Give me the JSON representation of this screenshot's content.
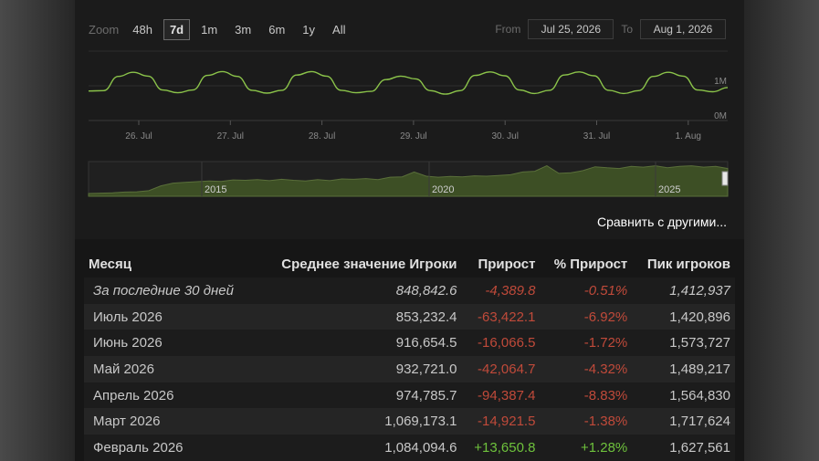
{
  "zoom": {
    "label": "Zoom",
    "options": [
      "48h",
      "7d",
      "1m",
      "3m",
      "6m",
      "1y",
      "All"
    ],
    "active": "7d"
  },
  "range": {
    "from_label": "From",
    "from_value": "Jul 25, 2026",
    "to_label": "To",
    "to_value": "Aug 1, 2026"
  },
  "chart_data": {
    "type": "line",
    "x_ticks": [
      "26. Jul",
      "27. Jul",
      "28. Jul",
      "29. Jul",
      "30. Jul",
      "31. Jul",
      "1. Aug"
    ],
    "y_ticks": [
      "1M",
      "0M"
    ],
    "ylim": [
      0,
      2000000
    ],
    "line_color": "#8bc34a",
    "series": [
      {
        "values": [
          850000,
          860000,
          1270000,
          1390000,
          1280000,
          880000,
          800000,
          880000,
          1300000,
          1410000,
          1270000,
          870000,
          790000,
          870000,
          1310000,
          1410000,
          1280000,
          870000,
          800000,
          840000,
          1180000,
          1280000,
          1200000,
          860000,
          760000,
          860000,
          1300000,
          1400000,
          1290000,
          880000,
          780000,
          870000,
          1310000,
          1400000,
          1290000,
          870000,
          780000,
          860000,
          1270000,
          1390000,
          1280000,
          880000,
          830000,
          950000
        ]
      }
    ]
  },
  "navigator": {
    "year_labels": [
      "2015",
      "2020",
      "2025"
    ],
    "area_color": "#3d4f25"
  },
  "compare_link": "Сравнить с другими...",
  "table": {
    "headers": [
      "Месяц",
      "Среднее значение Игроки",
      "Прирост",
      "% Прирост",
      "Пик игроков"
    ],
    "rows": [
      {
        "month": "За последние 30 дней",
        "avg": "848,842.6",
        "gain": "-4,389.8",
        "pct": "-0.51%",
        "peak": "1,412,937",
        "sign": "neg"
      },
      {
        "month": "Июль 2026",
        "avg": "853,232.4",
        "gain": "-63,422.1",
        "pct": "-6.92%",
        "peak": "1,420,896",
        "sign": "neg"
      },
      {
        "month": "Июнь 2026",
        "avg": "916,654.5",
        "gain": "-16,066.5",
        "pct": "-1.72%",
        "peak": "1,573,727",
        "sign": "neg"
      },
      {
        "month": "Май 2026",
        "avg": "932,721.0",
        "gain": "-42,064.7",
        "pct": "-4.32%",
        "peak": "1,489,217",
        "sign": "neg"
      },
      {
        "month": "Апрель 2026",
        "avg": "974,785.7",
        "gain": "-94,387.4",
        "pct": "-8.83%",
        "peak": "1,564,830",
        "sign": "neg"
      },
      {
        "month": "Март 2026",
        "avg": "1,069,173.1",
        "gain": "-14,921.5",
        "pct": "-1.38%",
        "peak": "1,717,624",
        "sign": "neg"
      },
      {
        "month": "Февраль 2026",
        "avg": "1,084,094.6",
        "gain": "+13,650.8",
        "pct": "+1.28%",
        "peak": "1,627,561",
        "sign": "pos"
      }
    ]
  }
}
